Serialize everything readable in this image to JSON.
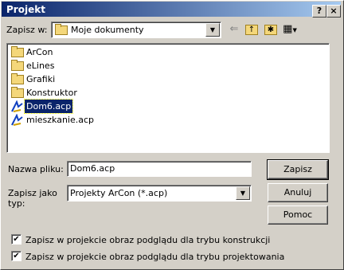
{
  "window": {
    "title": "Projekt",
    "help_glyph": "?",
    "close_glyph": "×"
  },
  "location": {
    "label": "Zapisz w:",
    "value": "Moje dokumenty"
  },
  "toolbar": {
    "back_glyph": "⇐",
    "up_glyph": "↑",
    "new_folder_glyph": "✱",
    "view_glyph": "▦"
  },
  "files": [
    {
      "name": "ArCon",
      "icon": "folder-icon"
    },
    {
      "name": "eLines",
      "icon": "folder-icon"
    },
    {
      "name": "Grafiki",
      "icon": "folder-icon"
    },
    {
      "name": "Konstruktor",
      "icon": "folder-icon"
    },
    {
      "name": "Dom6.acp",
      "icon": "arcon-file-icon",
      "selected": true
    },
    {
      "name": "mieszkanie.acp",
      "icon": "arcon-file-icon"
    }
  ],
  "filename": {
    "label": "Nazwa pliku:",
    "value": "Dom6.acp"
  },
  "filetype": {
    "label_line1": "Zapisz jako",
    "label_line2": "typ:",
    "value": "Projekty ArCon (*.acp)"
  },
  "buttons": {
    "save": "Zapisz",
    "cancel": "Anuluj",
    "help": "Pomoc"
  },
  "options": [
    {
      "label": "Zapisz w projekcie obraz podglądu dla trybu konstrukcji",
      "checked": true
    },
    {
      "label": "Zapisz w projekcie obraz podglądu dla trybu projektowania",
      "checked": true
    }
  ],
  "colors": {
    "title_start": "#0a246a",
    "title_end": "#a6caf0",
    "selection": "#0a246a",
    "face": "#d4d0c8"
  }
}
